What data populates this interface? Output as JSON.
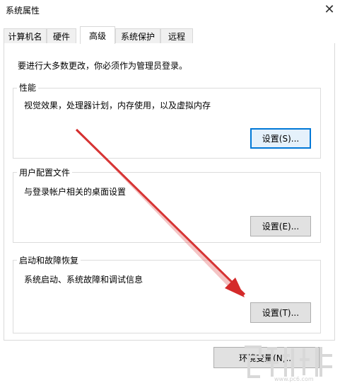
{
  "window": {
    "title": "系统属性"
  },
  "tabs": [
    {
      "label": "计算机名"
    },
    {
      "label": "硬件"
    },
    {
      "label": "高级"
    },
    {
      "label": "系统保护"
    },
    {
      "label": "远程"
    }
  ],
  "admin_note": "要进行大多数更改，你必须作为管理员登录。",
  "groups": {
    "performance": {
      "title": "性能",
      "description": "视觉效果，处理器计划，内存使用，以及虚拟内存",
      "button": "设置(S)..."
    },
    "user_profiles": {
      "title": "用户配置文件",
      "description": "与登录帐户相关的桌面设置",
      "button": "设置(E)..."
    },
    "startup_recovery": {
      "title": "启动和故障恢复",
      "description": "系统启动、系统故障和调试信息",
      "button": "设置(T)..."
    }
  },
  "env_button": "环境变量(N)...",
  "annotation": {
    "arrow_color": "#d42a2a"
  },
  "watermark": {
    "url": "www.pc6.com"
  }
}
